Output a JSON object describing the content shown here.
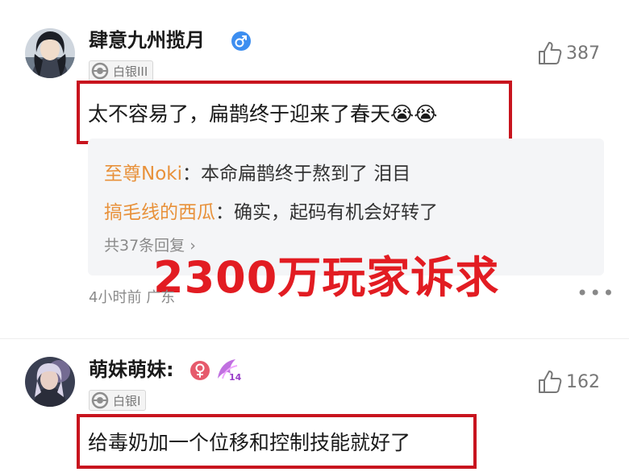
{
  "comments": [
    {
      "username": "肆意九州揽月",
      "gender_icon": "male-icon",
      "level": "白银III",
      "likes": "387",
      "text": "太不容易了，扁鹊终于迎来了春天😭😭",
      "replies": [
        {
          "author": "至尊Noki",
          "text": "：本命扁鹊终于熬到了 泪目"
        },
        {
          "author": "搞毛线的西瓜",
          "text": "：确实，起码有机会好转了"
        }
      ],
      "reply_count": "共37条回复 ›",
      "time": "4小时前",
      "location": "广东",
      "more": "•••"
    },
    {
      "username": "萌妹萌妹:",
      "gender_icon": "female-icon",
      "extra_badge": "14",
      "level": "白银I",
      "likes": "162",
      "text": "给毒奶加一个位移和控制技能就好了"
    }
  ],
  "overlay_caption": "2300万玩家诉求",
  "colors": {
    "highlight_border": "#c8141e",
    "reply_author": "#e8913a",
    "overlay_text": "#e21c22",
    "male_badge": "#3d8ef0",
    "female_badge": "#e65a6c"
  }
}
